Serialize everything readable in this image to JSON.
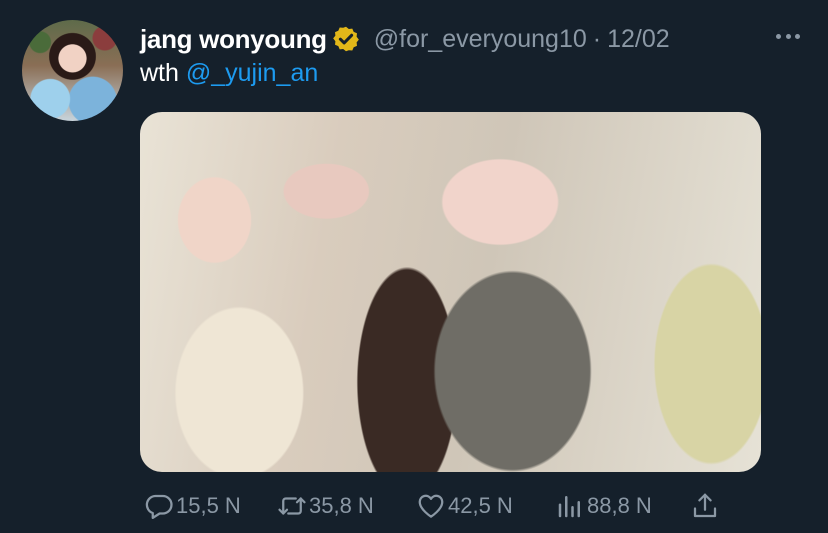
{
  "tweet": {
    "author_name": "jang wonyoung",
    "handle": "@for_everyoung10",
    "separator": "·",
    "date": "12/02",
    "text_prefix": "wth",
    "mention": "@_yujin_an"
  },
  "actions": {
    "replies": "15,5 N",
    "retweets": "35,8 N",
    "likes": "42,5 N",
    "views": "88,8 N"
  },
  "colors": {
    "background": "#15202b",
    "secondary_text": "#8b98a5",
    "link": "#1d9bf0",
    "verified_badge": "#e2b719"
  },
  "icons": [
    "verified-badge-icon",
    "more-options-icon",
    "reply-icon",
    "retweet-icon",
    "like-icon",
    "views-icon",
    "share-icon"
  ]
}
